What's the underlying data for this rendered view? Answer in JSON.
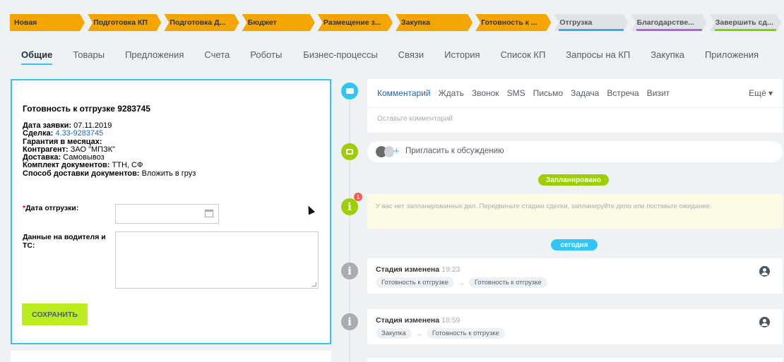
{
  "stages": [
    {
      "label": "Новая",
      "state": "done"
    },
    {
      "label": "Подготовка КП",
      "state": "done"
    },
    {
      "label": "Подготовка Д...",
      "state": "done"
    },
    {
      "label": "Бюджет",
      "state": "done"
    },
    {
      "label": "Размещение з...",
      "state": "done"
    },
    {
      "label": "Закупка",
      "state": "done"
    },
    {
      "label": "Готовность к ...",
      "state": "done"
    },
    {
      "label": "Отгрузка",
      "state": "todo",
      "underline": "#39a8ef"
    },
    {
      "label": "Благодарстве...",
      "state": "todo",
      "underline": "#bd5ce4"
    },
    {
      "label": "Завершить сд...",
      "state": "todo",
      "underline": "#7bd500"
    }
  ],
  "tabs": [
    "Общие",
    "Товары",
    "Предложения",
    "Счета",
    "Роботы",
    "Бизнес-процессы",
    "Связи",
    "История",
    "Список КП",
    "Запросы на КП",
    "Закупка",
    "Приложения"
  ],
  "form": {
    "title": "Готовность к отгрузке 9283745",
    "date_label": "Дата заявки:",
    "date_value": "07.11.2019",
    "deal_label": "Сделка:",
    "deal_value": "4.33-9283745",
    "warranty_label": "Гарантия в месяцах:",
    "contractor_label": "Контрагент:",
    "contractor_value": "ЗАО \"МПЗК\"",
    "delivery_label": "Доставка:",
    "delivery_value": "Самовывоз",
    "docs_label": "Комплект документов:",
    "docs_value": "ТТН, СФ",
    "docs_method_label": "Способ доставки документов:",
    "docs_method_value": "Вложить в груз",
    "shipment_required": "*",
    "shipment_label": "Дата отгрузки:",
    "driver_label": "Данные на водителя и ТС:",
    "save_label": "СОХРАНИТЬ"
  },
  "editor": {
    "tabs": [
      "Комментарий",
      "Ждать",
      "Звонок",
      "SMS",
      "Письмо",
      "Задача",
      "Встреча",
      "Визит"
    ],
    "more": "Ещё ▾",
    "placeholder": "Оставьте комментарий"
  },
  "invite_text": "Пригласить к обсуждению",
  "planned_label": "Запланировано",
  "planned_badge": "1",
  "planned_text": "У вас нет запланированных дел. Передвиньте стадию сделки, запланируйте дело или поставьте ожидание.",
  "today_label": "сегодня",
  "events": [
    {
      "title": "Стадия изменена",
      "time": "19:23",
      "from": "Готовность к отгрузке",
      "to": "Готовность к отгрузке"
    },
    {
      "title": "Стадия изменена",
      "time": "18:59",
      "from": "Закупка",
      "to": "Готовность к отгрузке"
    }
  ],
  "colors": {
    "accent": "#2fc6f6",
    "stage_done": "#f5a500",
    "stage_todo": "#dfe3e6",
    "save_button": "#bbed21",
    "planned_pill": "#9dcf00",
    "today_pill": "#2fc6f6",
    "badge": "#ff5752"
  },
  "icons": {
    "comment": "speech-bubble-icon",
    "chat": "chat-icon",
    "info": "info-icon",
    "calendar": "calendar-icon",
    "user": "user-icon"
  }
}
